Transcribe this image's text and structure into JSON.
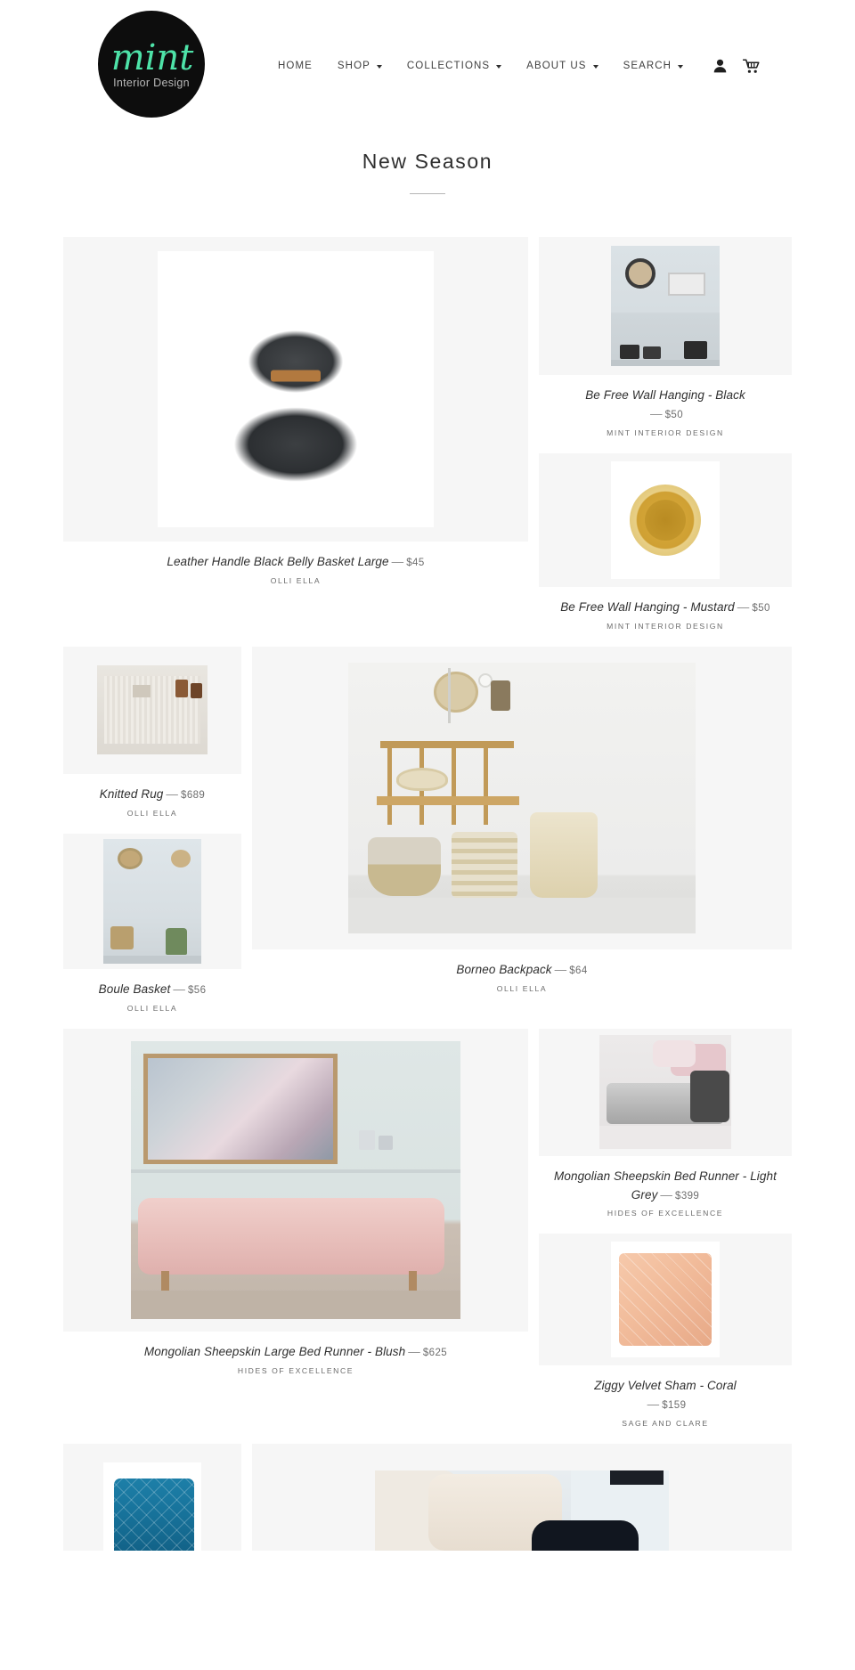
{
  "header": {
    "logo": {
      "brand": "mint",
      "tagline": "Interior Design",
      "brand_color": "#4ee2a8",
      "bg_color": "#0d0d0d"
    },
    "nav": [
      {
        "label": "HOME",
        "has_dropdown": false,
        "name": "nav-home"
      },
      {
        "label": "SHOP",
        "has_dropdown": true,
        "name": "nav-shop"
      },
      {
        "label": "COLLECTIONS",
        "has_dropdown": true,
        "name": "nav-collections"
      },
      {
        "label": "ABOUT US",
        "has_dropdown": true,
        "name": "nav-about-us"
      },
      {
        "label": "SEARCH",
        "has_dropdown": true,
        "name": "nav-search"
      }
    ],
    "icons": [
      {
        "name": "account-icon",
        "glyph": "person"
      },
      {
        "name": "cart-icon",
        "glyph": "cart"
      }
    ]
  },
  "collection": {
    "title": "New Season"
  },
  "products": [
    {
      "title": "Leather Handle Black Belly Basket Large",
      "price": "$45",
      "vendor": "OLLI ELLA",
      "name": "product-leather-handle-black-belly-basket-large"
    },
    {
      "title": "Be Free Wall Hanging - Black",
      "price": "$50",
      "vendor": "MINT INTERIOR DESIGN",
      "name": "product-be-free-wall-hanging-black"
    },
    {
      "title": "Be Free Wall Hanging - Mustard",
      "price": "$50",
      "vendor": "MINT INTERIOR DESIGN",
      "name": "product-be-free-wall-hanging-mustard"
    },
    {
      "title": "Knitted Rug",
      "price": "$689",
      "vendor": "OLLI ELLA",
      "name": "product-knitted-rug"
    },
    {
      "title": "Borneo Backpack",
      "price": "$64",
      "vendor": "OLLI ELLA",
      "name": "product-borneo-backpack"
    },
    {
      "title": "Boule Basket",
      "price": "$56",
      "vendor": "OLLI ELLA",
      "name": "product-boule-basket"
    },
    {
      "title": "Mongolian Sheepskin Bed Runner - Light Grey",
      "price": "$399",
      "vendor": "HIDES OF EXCELLENCE",
      "name": "product-mongolian-sheepskin-bed-runner-light-grey"
    },
    {
      "title": "Mongolian Sheepskin Large Bed Runner - Blush",
      "price": "$625",
      "vendor": "HIDES OF EXCELLENCE",
      "name": "product-mongolian-sheepskin-large-bed-runner-blush"
    },
    {
      "title": "Ziggy Velvet Sham - Coral",
      "price": "$159",
      "vendor": "SAGE AND CLARE",
      "name": "product-ziggy-velvet-sham-coral"
    }
  ],
  "separators": {
    "em_dash": "—"
  }
}
